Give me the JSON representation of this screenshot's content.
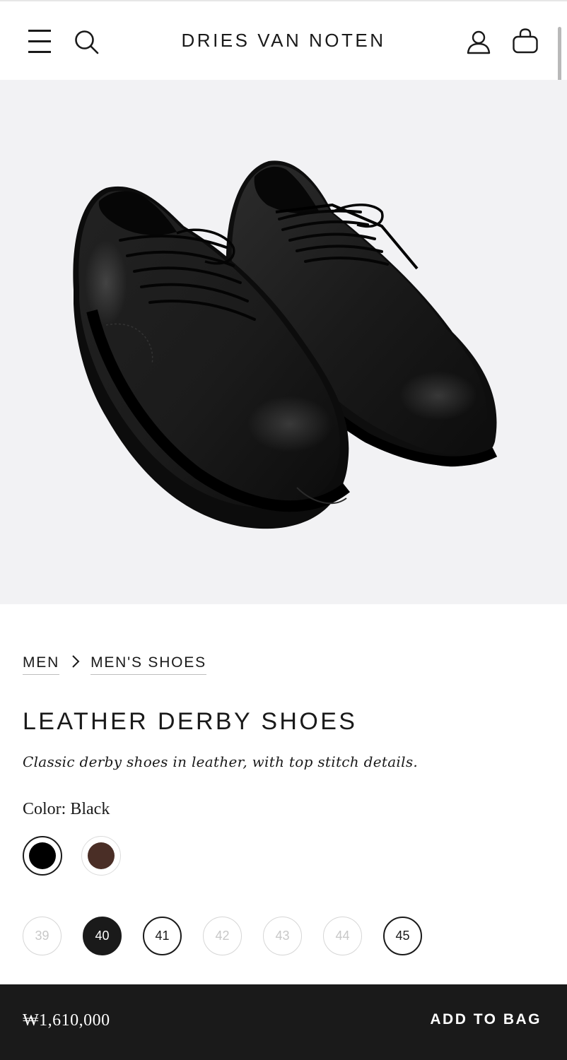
{
  "header": {
    "brand": "DRIES VAN NOTEN",
    "icons": [
      "menu-icon",
      "search-icon",
      "account-icon",
      "shopping-bag-icon"
    ]
  },
  "gallery": {
    "image_count": 5,
    "active_index": 2,
    "background": "#f2f2f4"
  },
  "breadcrumb": {
    "items": [
      {
        "label": "MEN"
      },
      {
        "label": "MEN'S SHOES"
      }
    ],
    "separator": ">"
  },
  "product": {
    "title": "LEATHER DERBY SHOES",
    "description": "Classic derby shoes in leather, with top stitch details.",
    "color_label": "Color: Black",
    "colors": [
      {
        "name": "Black",
        "hex": "#000000",
        "selected": true
      },
      {
        "name": "Brown",
        "hex": "#4a2e26",
        "selected": false
      }
    ],
    "sizes": [
      {
        "label": "39",
        "available": false,
        "selected": false
      },
      {
        "label": "40",
        "available": true,
        "selected": true
      },
      {
        "label": "41",
        "available": true,
        "selected": false
      },
      {
        "label": "42",
        "available": false,
        "selected": false
      },
      {
        "label": "43",
        "available": false,
        "selected": false
      },
      {
        "label": "44",
        "available": false,
        "selected": false
      },
      {
        "label": "45",
        "available": true,
        "selected": false
      }
    ]
  },
  "purchase_bar": {
    "price": "₩1,610,000",
    "add_to_bag": "ADD TO BAG"
  },
  "colors": {
    "text": "#1a1a1a",
    "bar": "#1a1a1a",
    "unavailable": "#c8c8c8"
  }
}
